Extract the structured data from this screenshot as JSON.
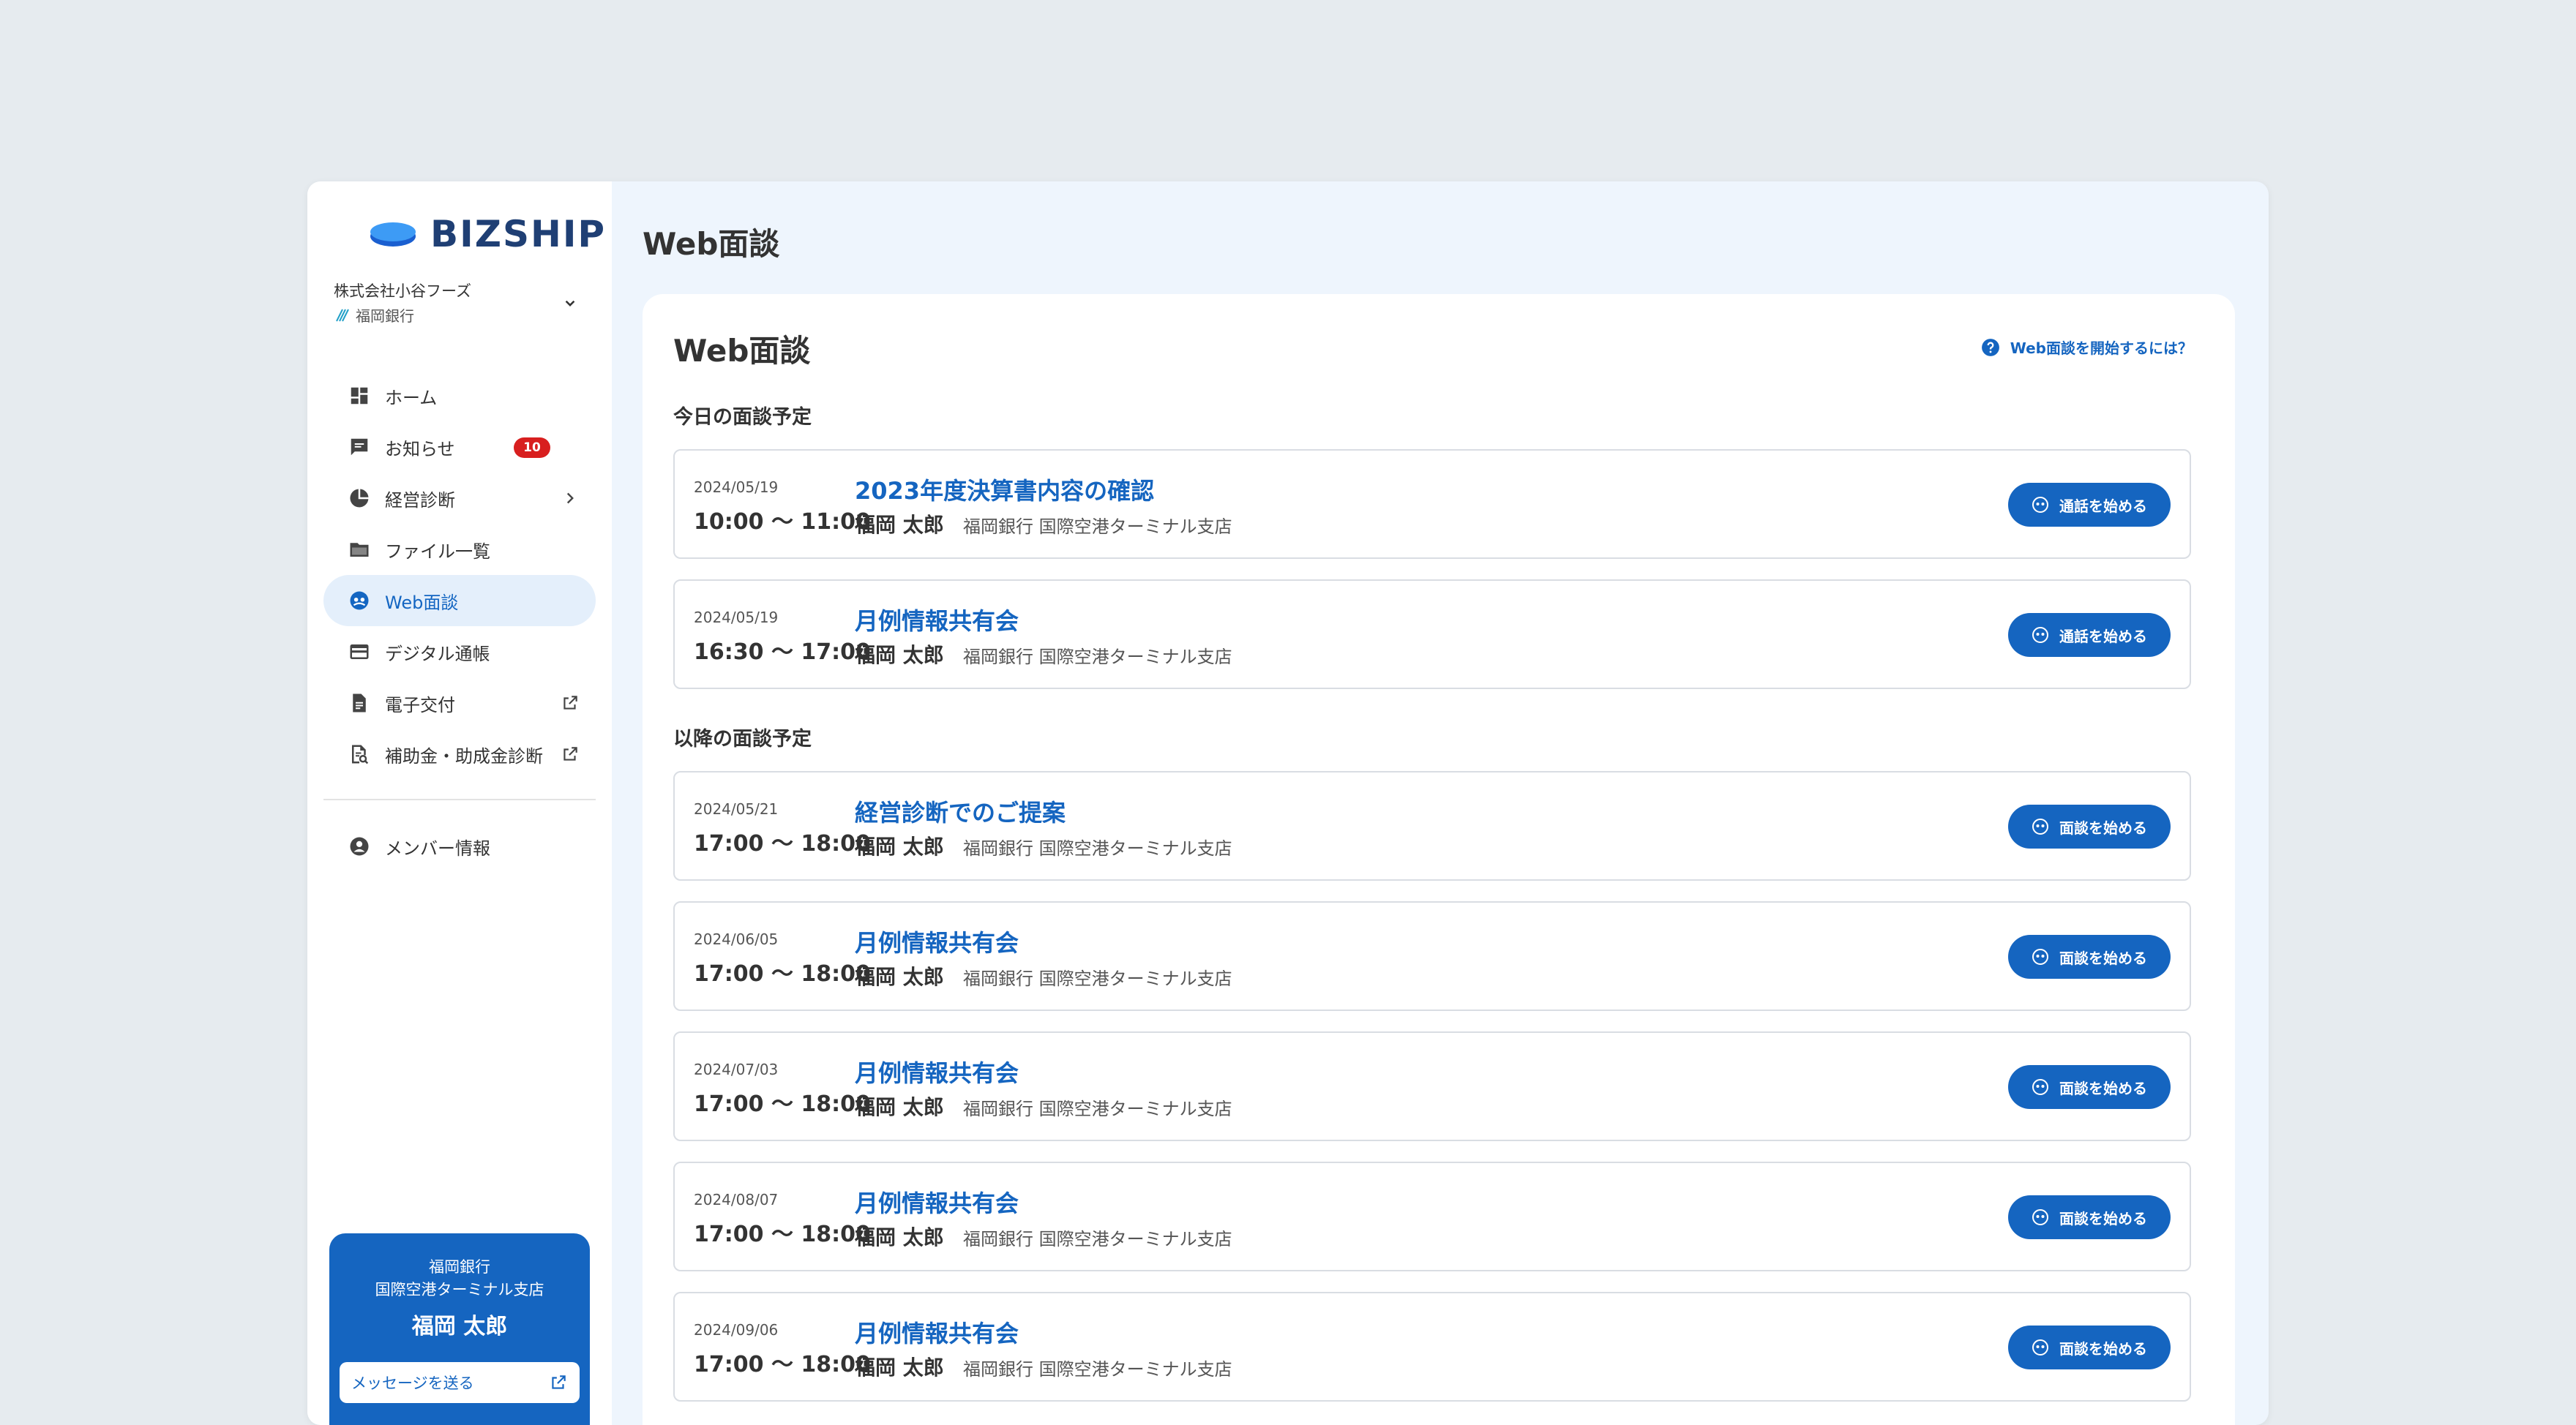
{
  "app": {
    "logo_text": "BIZSHIP",
    "brand_color": "#1565c0",
    "background": "#e6ebef"
  },
  "org_switcher": {
    "company": "株式会社小谷フーズ",
    "bank": "福岡銀行"
  },
  "sidebar": {
    "items": [
      {
        "label": "ホーム",
        "icon": "dashboard-icon"
      },
      {
        "label": "お知らせ",
        "icon": "chat-icon",
        "badge": "10"
      },
      {
        "label": "経営診断",
        "icon": "pie-chart-icon",
        "trailing": "chevron-right-icon"
      },
      {
        "label": "ファイル一覧",
        "icon": "folder-icon"
      },
      {
        "label": "Web面談",
        "icon": "video-call-icon",
        "active": true
      },
      {
        "label": "デジタル通帳",
        "icon": "card-icon"
      },
      {
        "label": "電子交付",
        "icon": "document-icon",
        "trailing": "external-link-icon"
      },
      {
        "label": "補助金・助成金診断",
        "icon": "search-document-icon",
        "trailing": "external-link-icon"
      },
      {
        "label": "メンバー情報",
        "icon": "account-icon"
      }
    ]
  },
  "contact_card": {
    "bank": "福岡銀行",
    "branch": "国際空港ターミナル支店",
    "person": "福岡 太郎",
    "message_button": "メッセージを送る"
  },
  "page": {
    "title": "Web面談",
    "card_title": "Web面談",
    "help_link": "Web面談を開始するには？"
  },
  "today": {
    "label": "今日の面談予定",
    "meetings": [
      {
        "date": "2024/05/19",
        "time": "10:00 〜 11:00",
        "title": "2023年度決算書内容の確認",
        "person": "福岡 太郎",
        "branch": "福岡銀行 国際空港ターミナル支店",
        "button": "通話を始める"
      },
      {
        "date": "2024/05/19",
        "time": "16:30 〜 17:00",
        "title": "月例情報共有会",
        "person": "福岡 太郎",
        "branch": "福岡銀行 国際空港ターミナル支店",
        "button": "通話を始める"
      }
    ]
  },
  "upcoming": {
    "label": "以降の面談予定",
    "meetings": [
      {
        "date": "2024/05/21",
        "time": "17:00 〜 18:00",
        "title": "経営診断でのご提案",
        "person": "福岡 太郎",
        "branch": "福岡銀行 国際空港ターミナル支店",
        "button": "面談を始める"
      },
      {
        "date": "2024/06/05",
        "time": "17:00 〜 18:00",
        "title": "月例情報共有会",
        "person": "福岡 太郎",
        "branch": "福岡銀行 国際空港ターミナル支店",
        "button": "面談を始める"
      },
      {
        "date": "2024/07/03",
        "time": "17:00 〜 18:00",
        "title": "月例情報共有会",
        "person": "福岡 太郎",
        "branch": "福岡銀行 国際空港ターミナル支店",
        "button": "面談を始める"
      },
      {
        "date": "2024/08/07",
        "time": "17:00 〜 18:00",
        "title": "月例情報共有会",
        "person": "福岡 太郎",
        "branch": "福岡銀行 国際空港ターミナル支店",
        "button": "面談を始める"
      },
      {
        "date": "2024/09/06",
        "time": "17:00 〜 18:00",
        "title": "月例情報共有会",
        "person": "福岡 太郎",
        "branch": "福岡銀行 国際空港ターミナル支店",
        "button": "面談を始める"
      }
    ]
  }
}
